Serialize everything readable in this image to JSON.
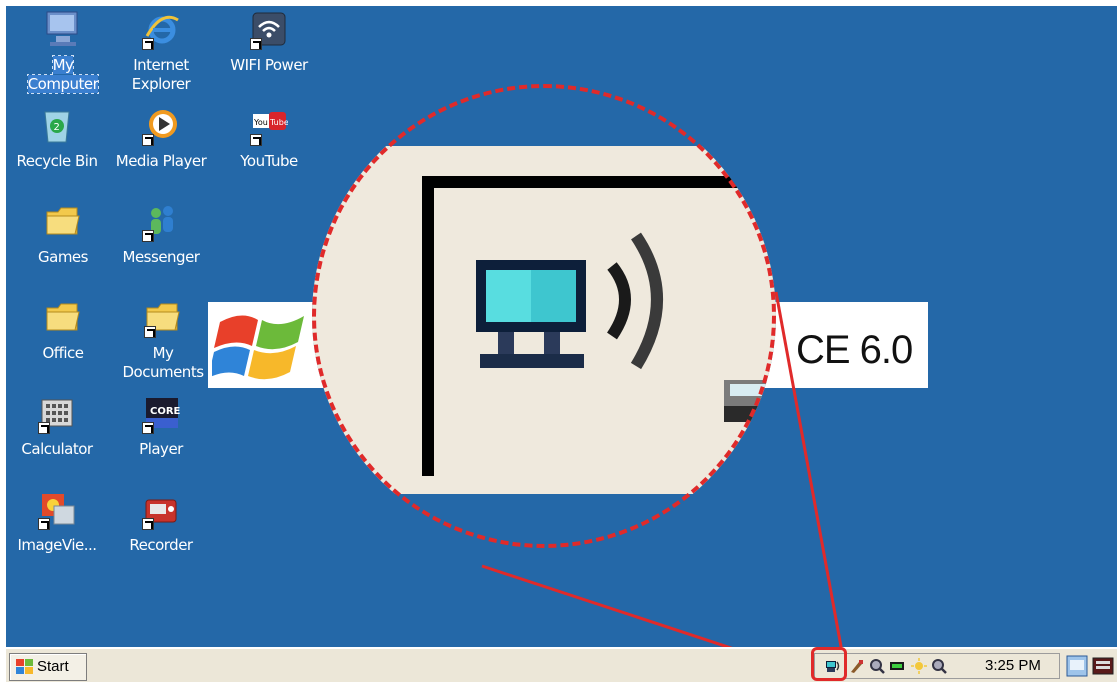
{
  "desktop": {
    "icons": [
      {
        "label": "My\nComputer"
      },
      {
        "label": "Internet\nExplorer"
      },
      {
        "label": "WIFI Power"
      },
      {
        "label": "Recycle Bin"
      },
      {
        "label": "Media Player"
      },
      {
        "label": "YouTube"
      },
      {
        "label": "Games"
      },
      {
        "label": "Messenger"
      },
      {
        "label": "Office"
      },
      {
        "label": "My\nDocuments"
      },
      {
        "label": "Calculator"
      },
      {
        "label": "Player"
      },
      {
        "label": "ImageVie..."
      },
      {
        "label": "Recorder"
      }
    ],
    "background_color": "#2468a8"
  },
  "banner": {
    "text": "CE 6.0"
  },
  "youtube_logo": {
    "you": "You",
    "tube": "Tube"
  },
  "player_logo": "CORE",
  "taskbar": {
    "start_label": "Start",
    "clock": "3:25 PM"
  },
  "colors": {
    "annotation_red": "#e02a2a",
    "taskbar": "#ece7d8"
  }
}
